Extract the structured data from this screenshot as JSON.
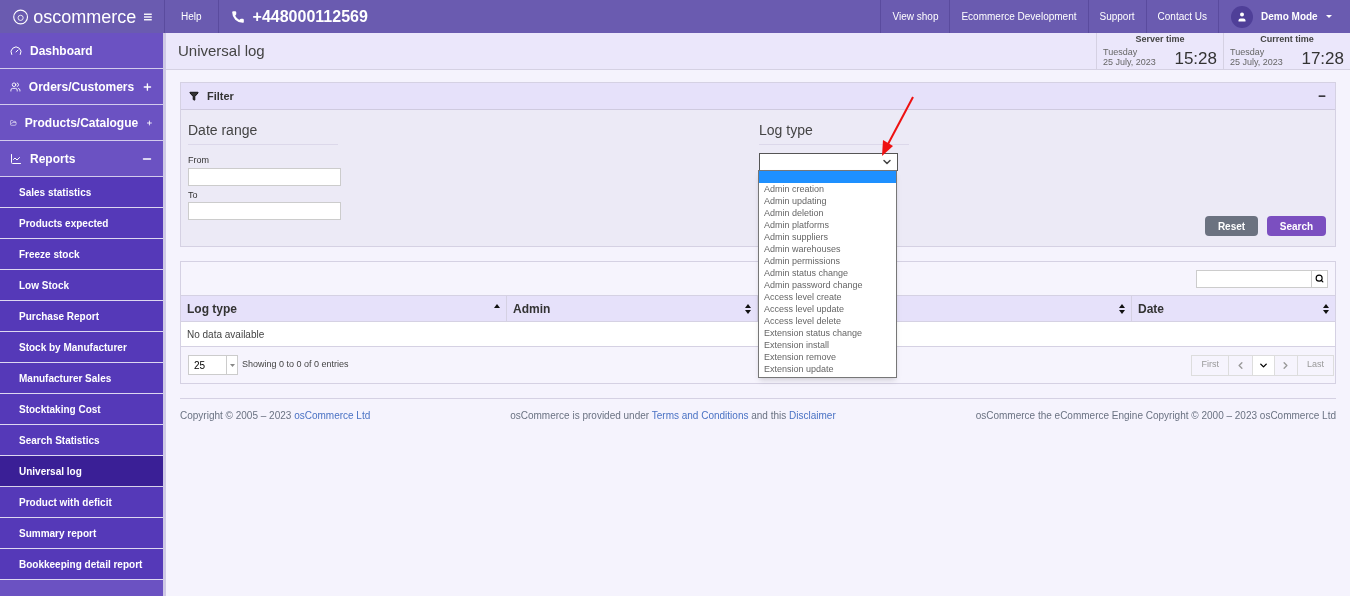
{
  "topbar": {
    "logo": "oscommerce",
    "help": "Help",
    "phone": "+448000112569",
    "links": [
      "View shop",
      "Ecommerce Development",
      "Support",
      "Contact Us"
    ],
    "user": "Demo Mode"
  },
  "sidebar": {
    "items": [
      {
        "label": "Dashboard",
        "kind": "dashboard",
        "has_toggle": false
      },
      {
        "label": "Orders/Customers",
        "kind": "customers",
        "expanded": false,
        "has_toggle": true
      },
      {
        "label": "Products/Catalogue",
        "kind": "catalogue",
        "expanded": false,
        "has_toggle": true
      },
      {
        "label": "Reports",
        "kind": "reports",
        "expanded": true,
        "has_toggle": true,
        "children": [
          {
            "label": "Sales statistics",
            "selected": false
          },
          {
            "label": "Products expected",
            "selected": false
          },
          {
            "label": "Freeze stock",
            "selected": false
          },
          {
            "label": "Low Stock",
            "selected": false
          },
          {
            "label": "Purchase Report",
            "selected": false
          },
          {
            "label": "Stock by Manufacturer",
            "selected": false
          },
          {
            "label": "Manufacturer Sales",
            "selected": false
          },
          {
            "label": "Stocktaking Cost",
            "selected": false
          },
          {
            "label": "Search Statistics",
            "selected": false
          },
          {
            "label": "Universal log",
            "selected": true
          },
          {
            "label": "Product with deficit",
            "selected": false
          },
          {
            "label": "Summary report",
            "selected": false
          },
          {
            "label": "Bookkeeping detail report",
            "selected": false
          }
        ]
      }
    ]
  },
  "header": {
    "title": "Universal log",
    "clocks": [
      {
        "label": "Server time",
        "day": "Tuesday",
        "date": "25 July, 2023",
        "time": "15:28"
      },
      {
        "label": "Current time",
        "day": "Tuesday",
        "date": "25 July, 2023",
        "time": "17:28"
      }
    ]
  },
  "filter": {
    "title": "Filter",
    "date_range": {
      "title": "Date range",
      "from_label": "From",
      "to_label": "To"
    },
    "log_type": {
      "title": "Log type",
      "expanded": true,
      "options": [
        {
          "selected": true
        },
        {
          "label": "Admin creation",
          "selected": false
        },
        {
          "label": "Admin updating",
          "selected": false
        },
        {
          "label": "Admin deletion",
          "selected": false
        },
        {
          "label": "Admin platforms",
          "selected": false
        },
        {
          "label": "Admin suppliers",
          "selected": false
        },
        {
          "label": "Admin warehouses",
          "selected": false
        },
        {
          "label": "Admin permissions",
          "selected": false
        },
        {
          "label": "Admin status change",
          "selected": false
        },
        {
          "label": "Admin password change",
          "selected": false
        },
        {
          "label": "Access level create",
          "selected": false
        },
        {
          "label": "Access level update",
          "selected": false
        },
        {
          "label": "Access level delete",
          "selected": false
        },
        {
          "label": "Extension status change",
          "selected": false
        },
        {
          "label": "Extension install",
          "selected": false
        },
        {
          "label": "Extension remove",
          "selected": false
        },
        {
          "label": "Extension update",
          "selected": false
        }
      ]
    },
    "buttons": [
      "Reset",
      "Search"
    ]
  },
  "table": {
    "columns": [
      {
        "label": "Log type",
        "sorted": true
      },
      {
        "label": "Admin",
        "sorted": false
      },
      {
        "sorted": false
      },
      {
        "label": "Date",
        "sorted": false
      }
    ],
    "empty": "No data available",
    "page_size": "25",
    "info": "Showing 0 to 0 of 0 entries",
    "pager": {
      "first": "First",
      "last": "Last"
    }
  },
  "footer": {
    "left": [
      {
        "kind": "text",
        "text": "Copyright © 2005 – 2023 "
      },
      {
        "kind": "link",
        "text": "osCommerce Ltd"
      }
    ],
    "center": [
      {
        "kind": "text",
        "text": "osCommerce is provided under "
      },
      {
        "kind": "link",
        "text": "Terms and Conditions"
      },
      {
        "kind": "text",
        "text": " and this "
      },
      {
        "kind": "link",
        "text": "Disclaimer"
      }
    ],
    "right": [
      {
        "kind": "text",
        "text": "osCommerce the eCommerce Engine Copyright © 2000 – 2023 osCommerce Ltd"
      }
    ]
  }
}
